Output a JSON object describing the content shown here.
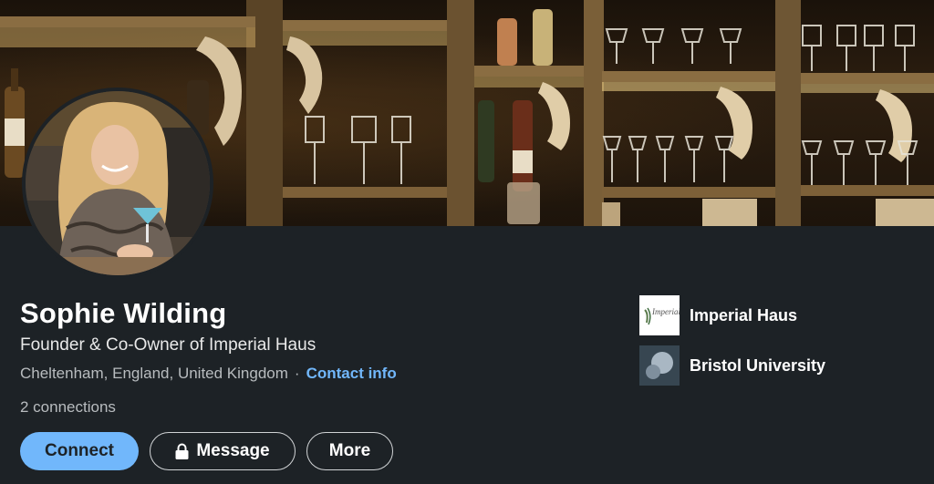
{
  "profile": {
    "name": "Sophie Wilding",
    "headline": "Founder & Co-Owner of Imperial Haus",
    "location": "Cheltenham, England, United Kingdom",
    "separator": "·",
    "contact_label": "Contact info",
    "connections": "2 connections"
  },
  "actions": {
    "connect_label": "Connect",
    "message_label": "Message",
    "more_label": "More"
  },
  "organizations": [
    {
      "name": "Imperial Haus",
      "logo_icon": "imperial-haus-logo",
      "logo_text": "Imperial Haus"
    },
    {
      "name": "Bristol University",
      "logo_icon": "bristol-university-logo"
    }
  ],
  "colors": {
    "background": "#1d2226",
    "accent": "#71b7fb",
    "muted_text": "#b8bcbf"
  }
}
